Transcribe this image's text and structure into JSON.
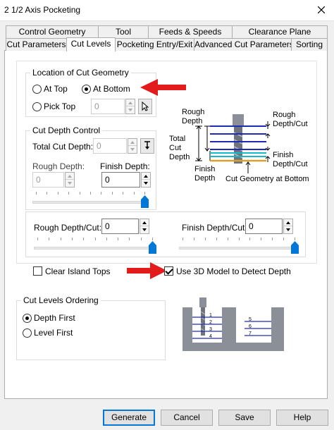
{
  "window": {
    "title": "2 1/2 Axis Pocketing"
  },
  "tabs": {
    "row_back": [
      {
        "label": "Control Geometry"
      },
      {
        "label": "Tool"
      },
      {
        "label": "Feeds & Speeds"
      },
      {
        "label": "Clearance Plane"
      }
    ],
    "row_front": [
      {
        "label": "Cut Parameters"
      },
      {
        "label": "Cut Levels"
      },
      {
        "label": "Pocketing Entry/Exit"
      },
      {
        "label": "Advanced Cut Parameters"
      },
      {
        "label": "Sorting"
      }
    ],
    "active": "Cut Levels"
  },
  "location": {
    "legend": "Location of Cut Geometry",
    "at_top": "At Top",
    "at_bottom": "At Bottom",
    "pick_top": "Pick Top",
    "pick_top_value": "0",
    "selected": "at_bottom"
  },
  "depth_control": {
    "legend": "Cut Depth Control",
    "total_label": "Total Cut Depth:",
    "total_value": "0",
    "rough_label": "Rough Depth:",
    "rough_value": "0",
    "finish_label": "Finish Depth:",
    "finish_value": "0",
    "finish_slider_percent": 100
  },
  "depth_per_cut": {
    "rough_label": "Rough Depth/Cut:",
    "rough_value": "0",
    "finish_label": "Finish Depth/Cut:",
    "finish_value": "0",
    "rough_slider_percent": 100,
    "finish_slider_percent": 100
  },
  "options": {
    "clear_island_tops": "Clear Island Tops",
    "clear_island_tops_checked": false,
    "use_3d_model": "Use 3D Model to Detect Depth",
    "use_3d_model_checked": true
  },
  "ordering": {
    "legend": "Cut Levels Ordering",
    "depth_first": "Depth First",
    "level_first": "Level First",
    "selected": "depth_first"
  },
  "diagram": {
    "rough_depth": [
      "Rough",
      "Depth"
    ],
    "total_cut_depth": [
      "Total",
      "Cut",
      "Depth"
    ],
    "finish_depth": [
      "Finish",
      "Depth"
    ],
    "rough_depth_cut": [
      "Rough",
      "Depth/Cut"
    ],
    "finish_depth_cut": [
      "Finish",
      "Depth/Cut"
    ],
    "cut_geometry": "Cut Geometry at Bottom"
  },
  "ordering_diagram": {
    "left_numbers": [
      "1",
      "2",
      "3",
      "4"
    ],
    "right_numbers": [
      "5",
      "6",
      "7"
    ]
  },
  "buttons": {
    "generate": "Generate",
    "cancel": "Cancel",
    "save": "Save",
    "help": "Help"
  },
  "colors": {
    "annotation_arrow": "#e31b1b",
    "slider_thumb": "#0078d7",
    "pass_line": "#1f2bb8",
    "finish_line": "#19b8c8",
    "geometry_line": "#d9a12b",
    "stock_fill": "#8a8f98"
  }
}
